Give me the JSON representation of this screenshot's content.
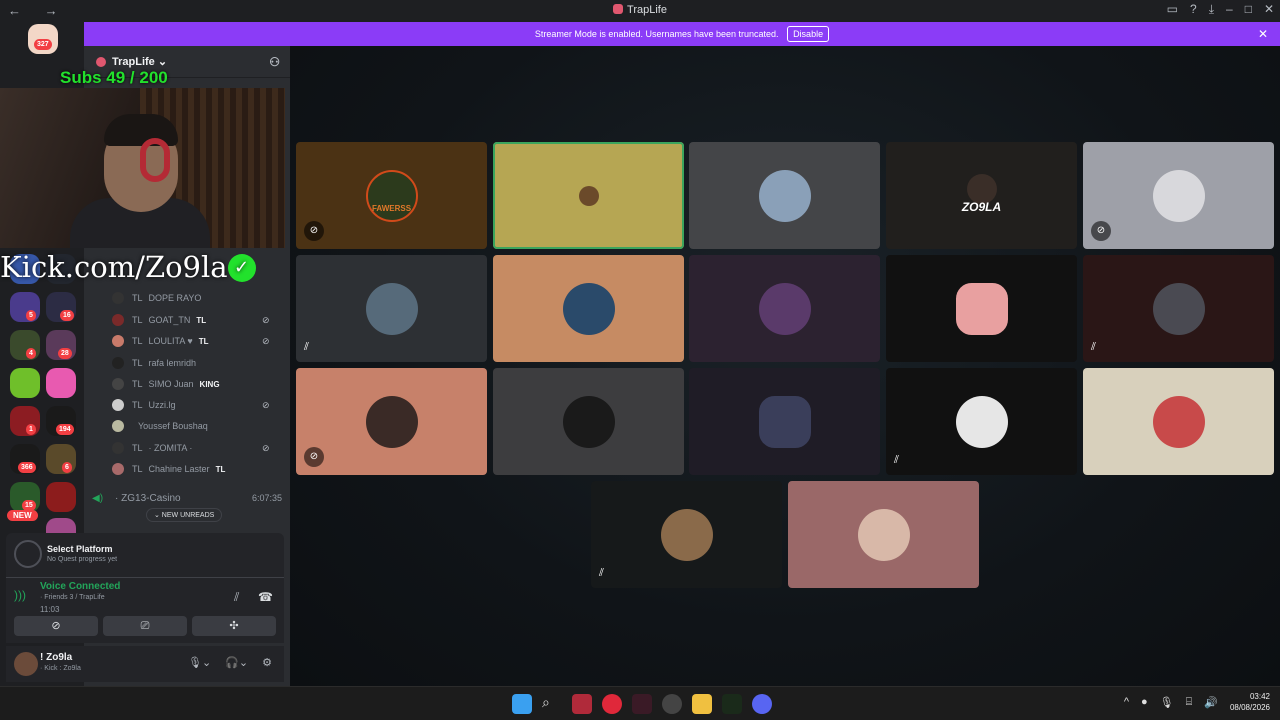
{
  "window": {
    "title": "TrapLife",
    "nav": "← →"
  },
  "banner": {
    "text": "Streamer Mode is enabled. Usernames have been truncated.",
    "button": "Disable",
    "close": "✕"
  },
  "guilds": {
    "top_badge": "327",
    "badges": [
      "5",
      "16",
      "4",
      "28",
      "1",
      "194",
      "366",
      "6",
      "15"
    ],
    "new_label": "NEW"
  },
  "server": {
    "name": "TrapLife ⌄"
  },
  "overlay": {
    "subs": "Subs 49 / 200",
    "kick": "Kick.com/Zo9la",
    "check": "✓"
  },
  "members": [
    {
      "tag": "TL",
      "name": "DOPE RAYO",
      "badge": "",
      "mute": ""
    },
    {
      "tag": "TL",
      "name": "GOAT_TN",
      "badge": "TL",
      "mute": "⊘"
    },
    {
      "tag": "TL",
      "name": "LOULITA ♥",
      "badge": "TL",
      "mute": "⊘"
    },
    {
      "tag": "TL",
      "name": "rafa lemridh",
      "badge": "",
      "mute": ""
    },
    {
      "tag": "TL",
      "name": "SIMO Juan",
      "badge": "KING",
      "mute": ""
    },
    {
      "tag": "TL",
      "name": "Uzzi.lg",
      "badge": "",
      "mute": "⊘"
    },
    {
      "tag": "",
      "name": "Youssef Boushaq",
      "badge": "",
      "mute": ""
    },
    {
      "tag": "TL",
      "name": "· ZOMITA ·",
      "badge": "",
      "mute": "⊘"
    },
    {
      "tag": "TL",
      "name": "Chahine Laster",
      "badge": "TL",
      "mute": ""
    }
  ],
  "channel": {
    "name": "· ZG13-Casino",
    "time": "6:07:35"
  },
  "new_unreads": "⌄ NEW UNREADS",
  "quest": {
    "title": "Select Platform",
    "subtitle": "No Quest progress yet"
  },
  "voice": {
    "status": "Voice Connected",
    "location": "· Friends 3 / TrapLife",
    "time": "11:03"
  },
  "user": {
    "name": "! Zo9la",
    "status": "· Kick : Zo9la"
  },
  "tiles": {
    "fawerss": "FAWERSS",
    "zo9la": "ZO9LA"
  },
  "clock": {
    "time": "03:42",
    "date": "08/08/2026"
  },
  "colors": {
    "accent": "#8b3cf7",
    "connected": "#23a55a",
    "overlay_green": "#22e12c"
  }
}
